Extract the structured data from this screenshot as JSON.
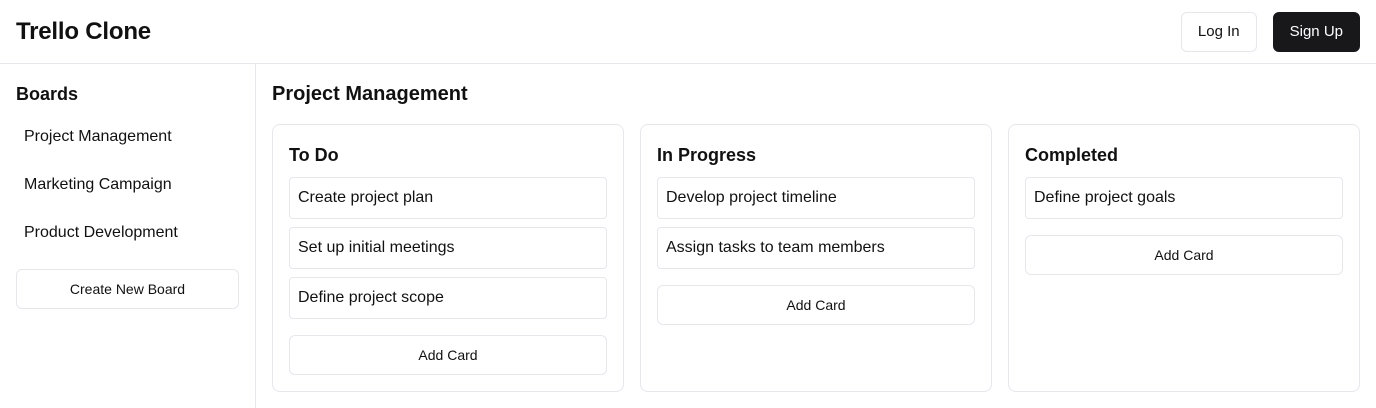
{
  "header": {
    "title": "Trello Clone",
    "login_label": "Log In",
    "signup_label": "Sign Up"
  },
  "sidebar": {
    "heading": "Boards",
    "boards": [
      "Project Management",
      "Marketing Campaign",
      "Product Development"
    ],
    "create_label": "Create New Board"
  },
  "main": {
    "board_title": "Project Management",
    "columns": [
      {
        "title": "To Do",
        "cards": [
          "Create project plan",
          "Set up initial meetings",
          "Define project scope"
        ],
        "add_label": "Add Card"
      },
      {
        "title": "In Progress",
        "cards": [
          "Develop project timeline",
          "Assign tasks to team members"
        ],
        "add_label": "Add Card"
      },
      {
        "title": "Completed",
        "cards": [
          "Define project goals"
        ],
        "add_label": "Add Card"
      }
    ]
  }
}
